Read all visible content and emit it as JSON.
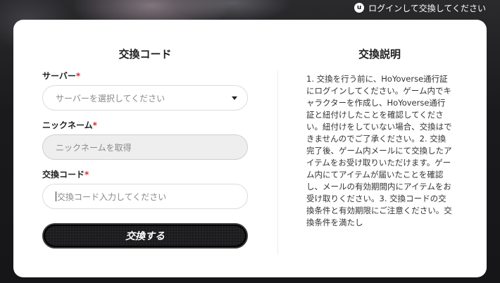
{
  "header": {
    "login_icon": "user-icon",
    "login_text": "ログインして交換してください"
  },
  "form": {
    "title": "交換コード",
    "server": {
      "label": "サーバー",
      "required_mark": "*",
      "placeholder": "サーバーを選択してください"
    },
    "nickname": {
      "label": "ニックネーム",
      "required_mark": "*",
      "placeholder": "ニックネームを取得"
    },
    "code": {
      "label": "交換コード",
      "required_mark": "*",
      "placeholder": "交換コード入力してください"
    },
    "submit_label": "交換する"
  },
  "info": {
    "title": "交換説明",
    "text": "1. 交換を行う前に、HoYoverse通行証にログインしてください。ゲーム内でキャラクターを作成し、HoYoverse通行証と紐付けしたことを確認してください。紐付けをしていない場合、交換はできませんのでご了承ください。2. 交換完了後、ゲーム内メールにて交換したアイテムをお受け取りいただけます。ゲーム内にてアイテムが届いたことを確認し、メールの有効期間内にアイテムをお受け取りください。3. 交換コードの交換条件と有効期限にご注意ください。交換条件を満たし"
  }
}
